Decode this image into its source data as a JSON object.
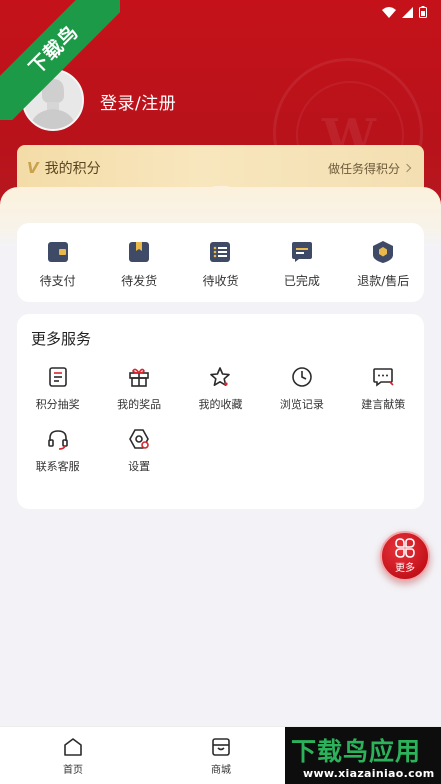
{
  "watermark": {
    "ribbon_text": "下载鸟",
    "bottom_title": "下载鸟应用",
    "bottom_url": "www.xiazainiao.com"
  },
  "profile": {
    "login_label": "登录/注册"
  },
  "points": {
    "label": "我的积分",
    "action": "做任务得积分"
  },
  "orders": [
    {
      "label": "待支付",
      "icon": "wallet-icon"
    },
    {
      "label": "待发货",
      "icon": "bookmark-box-icon"
    },
    {
      "label": "待收货",
      "icon": "list-icon"
    },
    {
      "label": "已完成",
      "icon": "message-square-icon"
    },
    {
      "label": "退款/售后",
      "icon": "shield-hex-icon"
    }
  ],
  "services": {
    "title": "更多服务",
    "items": [
      {
        "label": "积分抽奖",
        "icon": "document-icon"
      },
      {
        "label": "我的奖品",
        "icon": "gift-icon"
      },
      {
        "label": "我的收藏",
        "icon": "star-icon"
      },
      {
        "label": "浏览记录",
        "icon": "clock-icon"
      },
      {
        "label": "建言献策",
        "icon": "chat-bubble-icon"
      },
      {
        "label": "联系客服",
        "icon": "headset-icon"
      },
      {
        "label": "设置",
        "icon": "settings-icon"
      }
    ]
  },
  "fab": {
    "label": "更多"
  },
  "bottom_nav": [
    {
      "label": "首页",
      "icon": "home-icon"
    },
    {
      "label": "商城",
      "icon": "store-icon"
    }
  ],
  "colors": {
    "header_red": "#c5121a",
    "points_gold": "#f3dca7",
    "watermark_green": "#1d9a47"
  }
}
